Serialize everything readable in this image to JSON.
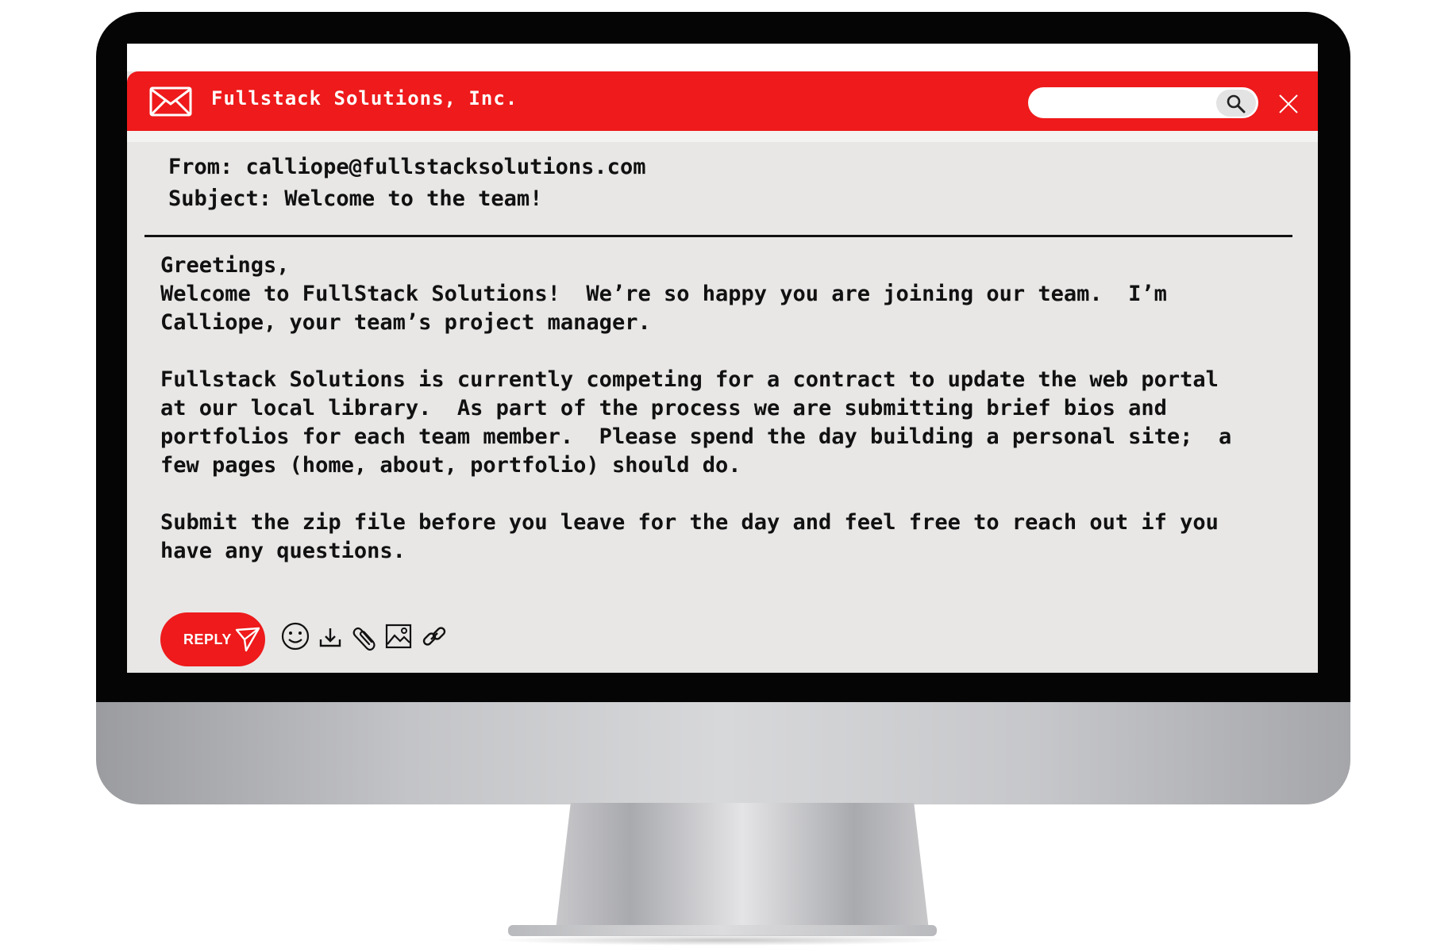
{
  "app": {
    "title": "Fullstack Solutions, Inc."
  },
  "search": {
    "placeholder": ""
  },
  "email": {
    "from_line": "From: calliope@fullstacksolutions.com",
    "subject_line": "Subject: Welcome to the team!",
    "body_lines": [
      "Greetings,",
      "Welcome to FullStack Solutions!  We’re so happy you are joining our team.  I’m",
      "Calliope, your team’s project manager.",
      "",
      "Fullstack Solutions is currently competing for a contract to update the web portal",
      "at our local library.  As part of the process we are submitting brief bios and",
      "portfolios for each team member.  Please spend the day building a personal site;  a",
      "few pages (home, about, portfolio) should do.",
      "",
      "Submit the zip file before you leave for the day and feel free to reach out if you",
      "have any questions."
    ]
  },
  "toolbar": {
    "reply_label": "REPLY",
    "icons": [
      "smiley-icon",
      "download-icon",
      "paperclip-icon",
      "image-icon",
      "link-icon"
    ]
  },
  "colors": {
    "accent": "#ee1a1b",
    "screen_bg": "#e8e7e6",
    "bezel": "#050505"
  }
}
